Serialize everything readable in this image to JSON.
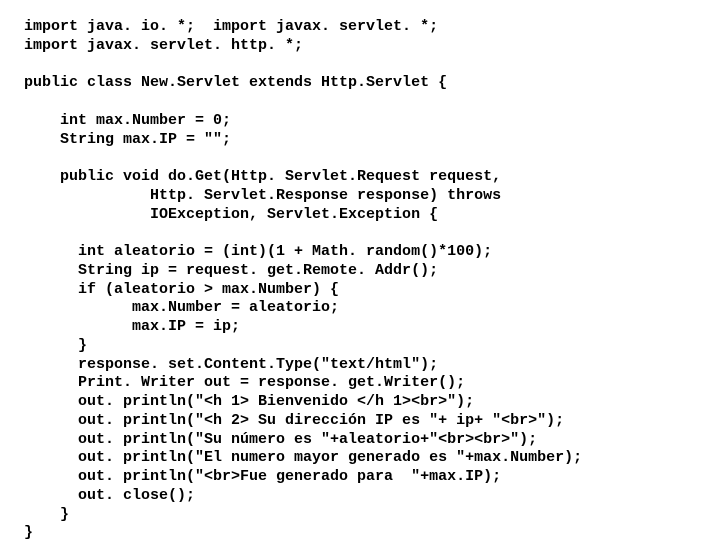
{
  "code": {
    "lines": [
      "import java. io. *;  import javax. servlet. *;",
      "import javax. servlet. http. *;",
      "",
      "public class New.Servlet extends Http.Servlet {",
      "",
      "    int max.Number = 0;",
      "    String max.IP = \"\";",
      "",
      "    public void do.Get(Http. Servlet.Request request,",
      "              Http. Servlet.Response response) throws",
      "              IOException, Servlet.Exception {",
      "",
      "      int aleatorio = (int)(1 + Math. random()*100);",
      "      String ip = request. get.Remote. Addr();",
      "      if (aleatorio > max.Number) {",
      "            max.Number = aleatorio;",
      "            max.IP = ip;",
      "      }",
      "      response. set.Content.Type(\"text/html\");",
      "      Print. Writer out = response. get.Writer();",
      "      out. println(\"<h 1> Bienvenido </h 1><br>\");",
      "      out. println(\"<h 2> Su dirección IP es \"+ ip+ \"<br>\");",
      "      out. println(\"Su número es \"+aleatorio+\"<br><br>\");",
      "      out. println(\"El numero mayor generado es \"+max.Number);",
      "      out. println(\"<br>Fue generado para  \"+max.IP);",
      "      out. close();",
      "    }",
      "}"
    ]
  }
}
